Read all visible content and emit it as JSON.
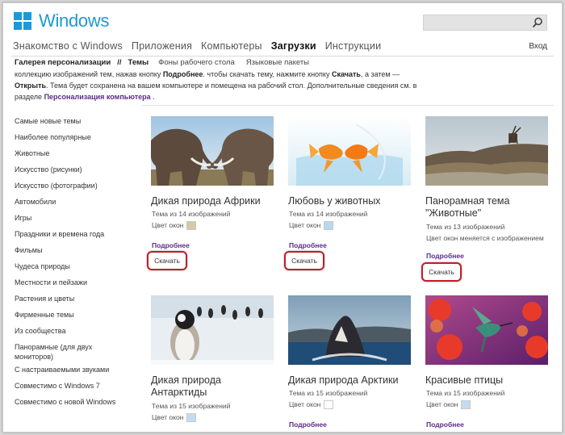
{
  "header": {
    "logo_text": "Windows",
    "search_placeholder": ""
  },
  "nav": {
    "items": [
      "Знакомство с Windows",
      "Приложения",
      "Компьютеры",
      "Загрузки",
      "Инструкции"
    ],
    "active": "Загрузки",
    "login": "Вход"
  },
  "breadcrumb": {
    "gallery": "Галерея персонализации",
    "sep": "//",
    "themes": "Темы",
    "wallpapers": "Фоны рабочего стола",
    "languages": "Языковые пакеты"
  },
  "intro": {
    "p1": "коллекцию изображений тем, нажав кнопку ",
    "b1": "Подробнее",
    "p2": ". чтобы скачать тему, нажмите кнопку ",
    "b2": "Скачать",
    "p3": ", а затем —",
    "b3": "Открыть",
    "p4": ". Тема будет сохранена на вашем компьютере и помещена на рабочий стол. Дополнительные сведения см. в разделе ",
    "link": "Персонализация компьютера",
    "p5": " ."
  },
  "sidebar": {
    "items": [
      "Самые новые темы",
      "Наиболее популярные",
      "Животные",
      "Искусство (рисунки)",
      "Искусство (фотографии)",
      "Автомобили",
      "Игры",
      "Праздники и времена года",
      "Фильмы",
      "Чудеса природы",
      "Местности и пейзажи",
      "Растения и цветы",
      "Фирменные темы",
      "Из сообщества",
      "Панорамные (для двух мониторов)",
      "С настраиваемыми звуками",
      "Совместимо с Windows 7",
      "Совместимо с новой Windows"
    ]
  },
  "cards": [
    {
      "title": "Дикая природа Африки",
      "count": "Тема из 14 изображений",
      "color_label": "Цвет окон",
      "color": "#d8c9a6",
      "more": "Подробнее",
      "download": "Скачать"
    },
    {
      "title": "Любовь у животных",
      "count": "Тема из 14 изображений",
      "color_label": "Цвет окон",
      "color": "#b7d8ee",
      "more": "Подробнее",
      "download": "Скачать"
    },
    {
      "title": "Панорамная тема \"Животные\"",
      "count": "Тема из 13 изображений",
      "color_label": "Цвет окон меняется с изображением",
      "color": "",
      "more": "Подробнее",
      "download": "Скачать"
    },
    {
      "title": "Дикая природа Антарктиды",
      "count": "Тема из 15 изображений",
      "color_label": "Цвет окон",
      "color": "#c3dcf2",
      "more": "Подробнее",
      "download": ""
    },
    {
      "title": "Дикая природа Арктики",
      "count": "Тема из 15 изображений",
      "color_label": "Цвет окон",
      "color": "#ffffff",
      "more": "Подробнее",
      "download": ""
    },
    {
      "title": "Красивые птицы",
      "count": "Тема из 15 изображений",
      "color_label": "Цвет окон",
      "color": "#c3dcf2",
      "more": "Подробнее",
      "download": ""
    }
  ],
  "colors": {
    "brand": "#1c9ad6",
    "link": "#5b2a86",
    "highlight": "#c21e28"
  }
}
